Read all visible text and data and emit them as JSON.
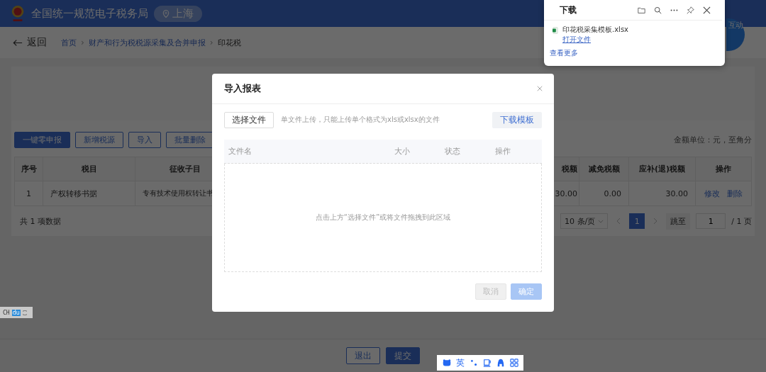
{
  "header": {
    "title": "全国统一规范电子税务局",
    "region": "上海",
    "mascot_label": "互动"
  },
  "breadcrumb": {
    "back": "返回",
    "items": [
      {
        "label": "首页",
        "link": true
      },
      {
        "separator": "›"
      },
      {
        "label": "财产和行为税税源采集及合并申报",
        "link": true
      },
      {
        "separator": "›"
      },
      {
        "label": "印花税",
        "link": false
      }
    ]
  },
  "toolbar": {
    "buttons": [
      {
        "label": "一键零申报",
        "kind": "primary"
      },
      {
        "label": "新增税源",
        "kind": "outline"
      },
      {
        "label": "导入",
        "kind": "outline"
      },
      {
        "label": "批量删除",
        "kind": "outline"
      }
    ],
    "unit_note": "金额单位：元，至角分"
  },
  "table": {
    "columns": [
      "序号",
      "税目",
      "征收子目",
      "",
      "税额",
      "减免税额",
      "应补(退)税额",
      "操作"
    ],
    "rows": [
      {
        "cells": [
          "1",
          "产权转移书据",
          "专有技术使用权转让书",
          "",
          "30.00",
          "0.00",
          "30.00"
        ],
        "actions": [
          "修改",
          "删除"
        ]
      }
    ]
  },
  "pagination": {
    "total": "共 1 项数据",
    "page_size": "10 条/页",
    "pages": [
      {
        "label": "1",
        "selected": true
      }
    ],
    "jump_label": "跳至",
    "jump_value": "1",
    "page_count": "/ 1 页"
  },
  "footer": {
    "buttons": [
      {
        "label": "退出",
        "kind": "outline"
      },
      {
        "label": "提交",
        "kind": "primary"
      }
    ]
  },
  "ime_status": {
    "lang": "CH",
    "logo": "du"
  },
  "ime_bar": {
    "mode": "英"
  },
  "modal": {
    "title": "导入报表",
    "choose_button": "选择文件",
    "hint": "单文件上传，只能上传单个格式为xls或xlsx的文件",
    "template_button": "下载模板",
    "columns": [
      "文件名",
      "大小",
      "状态",
      "操作"
    ],
    "empty_text": "点击上方“选择文件”或将文件拖拽到此区域",
    "buttons": [
      {
        "label": "取消",
        "kind": "cancel",
        "disabled": true
      },
      {
        "label": "确定",
        "kind": "ok",
        "disabled": true
      }
    ]
  },
  "downloads": {
    "title": "下载",
    "files": [
      {
        "name": "印花税采集模板.xlsx",
        "action": "打开文件"
      }
    ],
    "more": "查看更多"
  }
}
